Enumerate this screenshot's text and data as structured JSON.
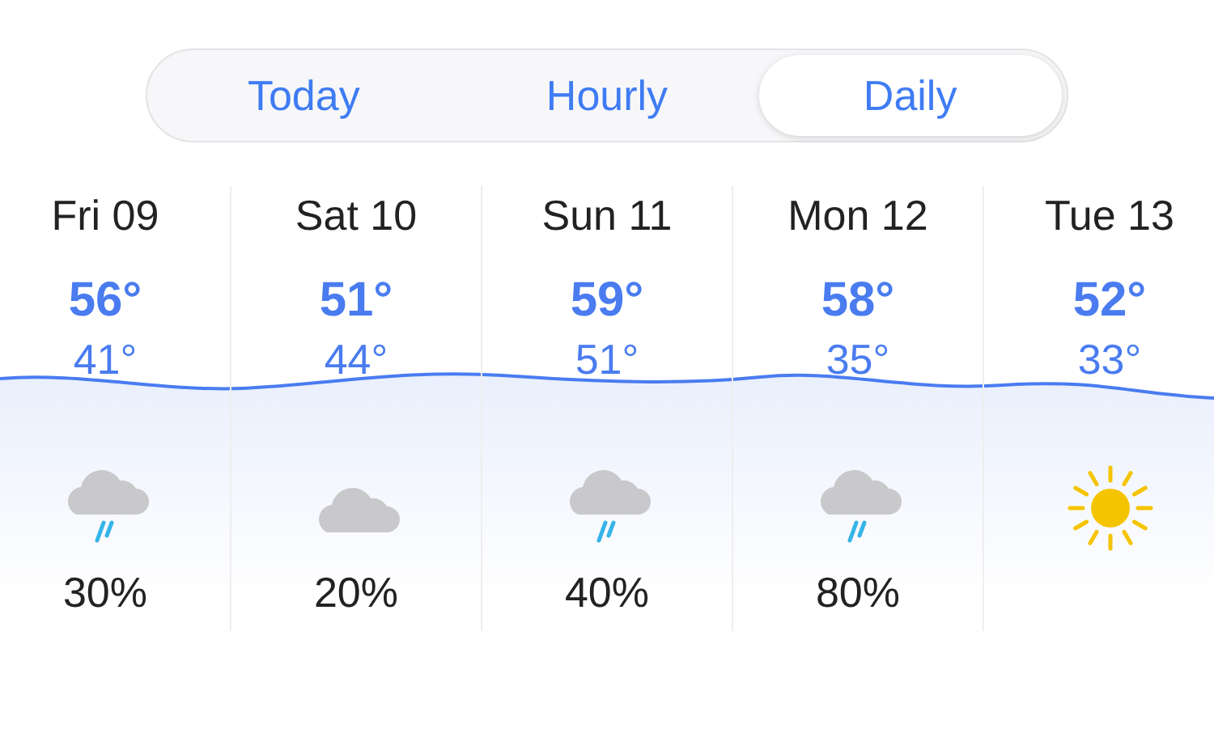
{
  "tabs": [
    {
      "label": "Today",
      "selected": false
    },
    {
      "label": "Hourly",
      "selected": false
    },
    {
      "label": "Daily",
      "selected": true
    }
  ],
  "days": [
    {
      "day": "Fri 09",
      "high": "56°",
      "low": "41°",
      "kind": "rain",
      "precip": "30%"
    },
    {
      "day": "Sat 10",
      "high": "51°",
      "low": "44°",
      "kind": "cloud",
      "precip": "20%"
    },
    {
      "day": "Sun 11",
      "high": "59°",
      "low": "51°",
      "kind": "rain",
      "precip": "40%"
    },
    {
      "day": "Mon 12",
      "high": "58°",
      "low": "35°",
      "kind": "rain",
      "precip": "80%"
    },
    {
      "day": "Tue 13",
      "high": "52°",
      "low": "33°",
      "kind": "sun"
    }
  ]
}
